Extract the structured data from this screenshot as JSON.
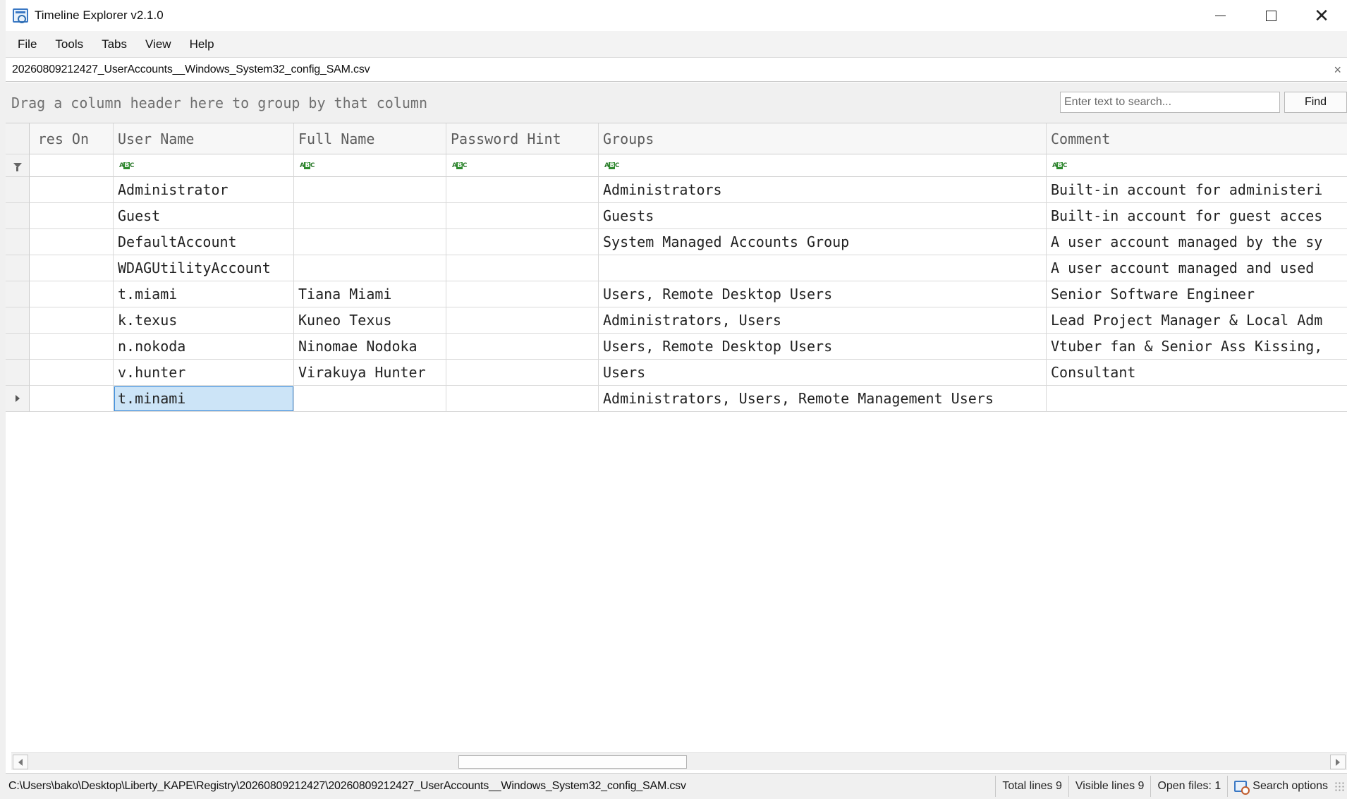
{
  "titlebar": {
    "title": "Timeline Explorer v2.1.0"
  },
  "menu": [
    "File",
    "Tools",
    "Tabs",
    "View",
    "Help"
  ],
  "tab": {
    "filename": "20260809212427_UserAccounts__Windows_System32_config_SAM.csv",
    "close_glyph": "×"
  },
  "group_panel": {
    "hint": "Drag a column header here to group by that column",
    "search_placeholder": "Enter text to search...",
    "find_label": "Find"
  },
  "columns": [
    "res On",
    "User Name",
    "Full Name",
    "Password Hint",
    "Groups",
    "Comment"
  ],
  "rows": [
    [
      "",
      "Administrator",
      "",
      "",
      "Administrators",
      "Built-in account for administeri"
    ],
    [
      "",
      "Guest",
      "",
      "",
      "Guests",
      "Built-in account for guest acces"
    ],
    [
      "",
      "DefaultAccount",
      "",
      "",
      "System Managed Accounts Group",
      "A user account managed by the sy"
    ],
    [
      "",
      "WDAGUtilityAccount",
      "",
      "",
      "",
      "A user account managed and used "
    ],
    [
      "",
      "t.miami",
      "Tiana Miami",
      "",
      "Users, Remote Desktop Users",
      "Senior Software Engineer"
    ],
    [
      "",
      "k.texus",
      "Kuneo Texus",
      "",
      "Administrators, Users",
      "Lead Project Manager & Local Adm"
    ],
    [
      "",
      "n.nokoda",
      "Ninomae Nodoka",
      "",
      "Users, Remote Desktop Users",
      "Vtuber fan & Senior Ass Kissing,"
    ],
    [
      "",
      "v.hunter",
      "Virakuya Hunter",
      "",
      "Users",
      "Consultant"
    ],
    [
      "",
      "t.minami",
      "",
      "",
      "Administrators, Users, Remote Management Users",
      ""
    ]
  ],
  "selected": {
    "row": 8,
    "column": "User Name"
  },
  "statusbar": {
    "path": "C:\\Users\\bako\\Desktop\\Liberty_KAPE\\Registry\\20260809212427\\20260809212427_UserAccounts__Windows_System32_config_SAM.csv",
    "total_lines": "Total lines 9",
    "visible_lines": "Visible lines 9",
    "open_files": "Open files: 1",
    "search_options": "Search options"
  },
  "colors": {
    "selection_fill": "#cce4f7",
    "selection_border": "#3b8ad9",
    "filter_icon": "#2e8b2e"
  }
}
